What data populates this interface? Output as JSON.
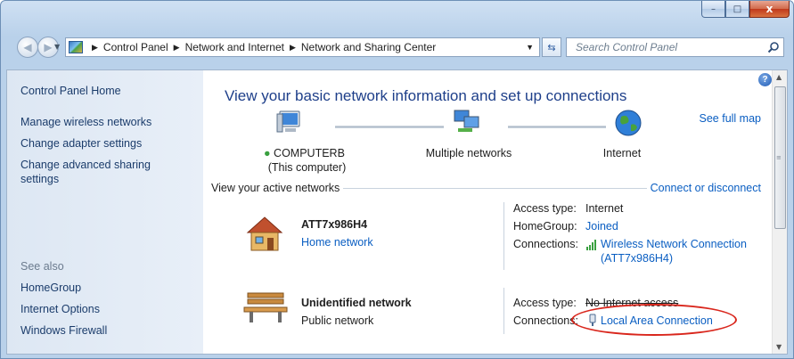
{
  "window": {
    "caption": {
      "minimize": "–",
      "maximize": "□",
      "close": "x"
    }
  },
  "address_bar": {
    "crumbs": [
      "Control Panel",
      "Network and Internet",
      "Network and Sharing Center"
    ]
  },
  "search": {
    "placeholder": "Search Control Panel"
  },
  "sidebar": {
    "home": "Control Panel Home",
    "links": [
      "Manage wireless networks",
      "Change adapter settings",
      "Change advanced sharing",
      "settings"
    ],
    "see_also_label": "See also",
    "see_also": [
      "HomeGroup",
      "Internet Options",
      "Windows Firewall"
    ]
  },
  "main": {
    "title": "View your basic network information and set up connections",
    "see_full_map": "See full map",
    "help": "?",
    "map": {
      "computer_name": "COMPUTERB",
      "computer_sub": "(This computer)",
      "middle": "Multiple networks",
      "internet": "Internet"
    },
    "active_networks_label": "View your active networks",
    "connect_link": "Connect or disconnect",
    "networks": [
      {
        "name": "ATT7x986H4",
        "type": "Home network",
        "access_type_key": "Access type:",
        "access_type_val": "Internet",
        "homegroup_key": "HomeGroup:",
        "homegroup_val": "Joined",
        "connections_key": "Connections:",
        "connections_val": "Wireless Network Connection",
        "connections_val2": "(ATT7x986H4)"
      },
      {
        "name": "Unidentified network",
        "type": "Public network",
        "access_type_key": "Access type:",
        "access_type_val": "No Internet access",
        "connections_key": "Connections:",
        "connections_val": "Local Area Connection"
      }
    ]
  },
  "colors": {
    "link": "#0a5ec2",
    "title": "#1e3f8a",
    "annotation": "#d9261c"
  }
}
